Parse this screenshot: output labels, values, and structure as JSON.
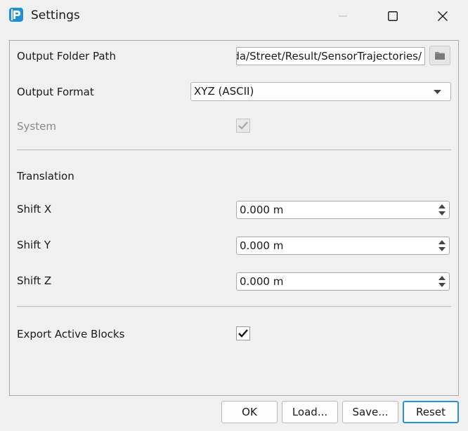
{
  "window": {
    "title": "Settings",
    "app_icon": "p-logo-icon",
    "controls": [
      "minimize-icon",
      "maximize-icon",
      "close-icon"
    ]
  },
  "output": {
    "folder_label": "Output Folder Path",
    "folder_value": "ada/Street/Result/SensorTrajectories/",
    "browse_icon": "folder-icon",
    "format_label": "Output Format",
    "format_value": "XYZ (ASCII)",
    "system_label": "System",
    "system_checked": true,
    "system_enabled": false
  },
  "translation": {
    "heading": "Translation",
    "shift_x_label": "Shift X",
    "shift_x_value": "0.000 m",
    "shift_y_label": "Shift Y",
    "shift_y_value": "0.000 m",
    "shift_z_label": "Shift Z",
    "shift_z_value": "0.000 m"
  },
  "export": {
    "active_blocks_label": "Export Active Blocks",
    "active_blocks_checked": true
  },
  "buttons": {
    "ok": "OK",
    "load": "Load...",
    "save": "Save...",
    "reset": "Reset"
  },
  "colors": {
    "accent": "#2a8dd8",
    "app_icon_blue": "#1f8fd6"
  }
}
